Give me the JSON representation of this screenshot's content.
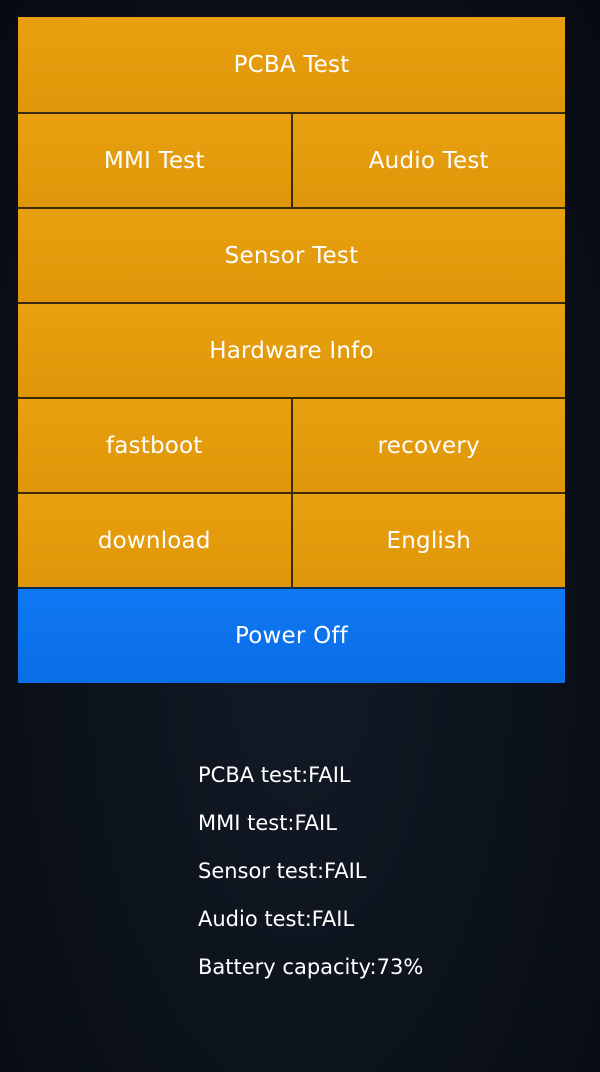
{
  "menu": {
    "pcba_test": "PCBA Test",
    "mmi_test": "MMI Test",
    "audio_test": "Audio Test",
    "sensor_test": "Sensor Test",
    "hardware_info": "Hardware Info",
    "fastboot": "fastboot",
    "recovery": "recovery",
    "download": "download",
    "language": "English",
    "power_off": "Power Off"
  },
  "results": [
    "PCBA test:FAIL",
    "MMI test:FAIL",
    "Sensor test:FAIL",
    "Audio test:FAIL",
    "Battery capacity:73%"
  ],
  "colors": {
    "tile": "#e39a0a",
    "power": "#0b73ee",
    "background": "#0c121b",
    "text": "#ffffff"
  }
}
